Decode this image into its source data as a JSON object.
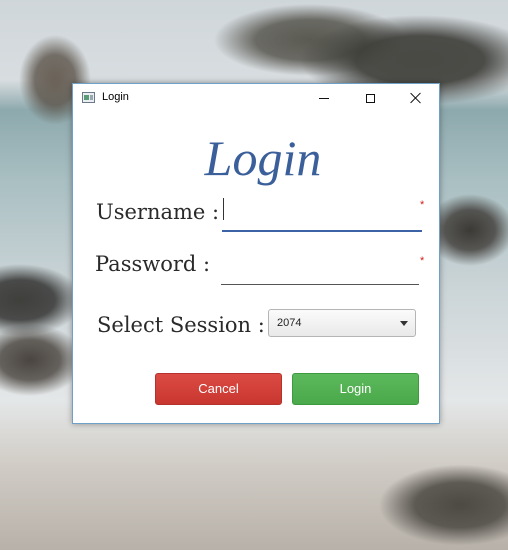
{
  "window": {
    "title": "Login"
  },
  "form": {
    "heading": "Login",
    "username_label": "Username :",
    "password_label": "Password :",
    "session_label": "Select Session :",
    "username_value": "",
    "password_value": "",
    "required_marker": "*",
    "session_selected": "2074"
  },
  "buttons": {
    "cancel": "Cancel",
    "login": "Login"
  },
  "colors": {
    "heading": "#3a5f9a",
    "cancel_button": "#d04039",
    "login_button": "#52b052",
    "required_marker": "#d02020",
    "focus_underline": "#3b63a6"
  },
  "icons": [
    "app-window-icon",
    "minimize-icon",
    "maximize-icon",
    "close-icon",
    "dropdown-arrow-icon"
  ]
}
